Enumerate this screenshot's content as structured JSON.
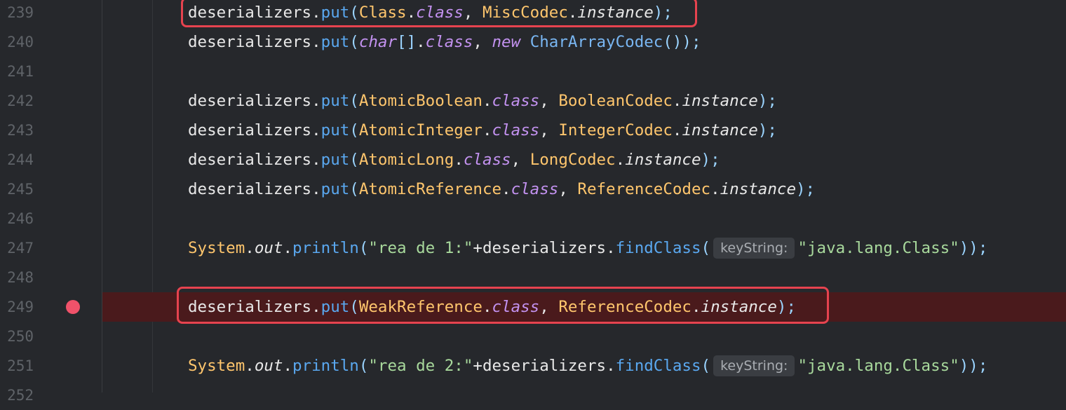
{
  "editor": {
    "lines": [
      {
        "num": "239",
        "parts": [
          {
            "t": "deserializers",
            "c": "t-obj"
          },
          {
            "t": ".",
            "c": "t-dot"
          },
          {
            "t": "put",
            "c": "t-meth"
          },
          {
            "t": "(",
            "c": "t-punc"
          },
          {
            "t": "Class",
            "c": "t-cls"
          },
          {
            "t": ".",
            "c": "t-dot"
          },
          {
            "t": "class",
            "c": "t-kw"
          },
          {
            "t": ", ",
            "c": "t-obj"
          },
          {
            "t": "MiscCodec",
            "c": "t-cls"
          },
          {
            "t": ".",
            "c": "t-dot"
          },
          {
            "t": "instance",
            "c": "t-inst"
          },
          {
            "t": ");",
            "c": "t-punc"
          }
        ]
      },
      {
        "num": "240",
        "parts": [
          {
            "t": "deserializers",
            "c": "t-obj"
          },
          {
            "t": ".",
            "c": "t-dot"
          },
          {
            "t": "put",
            "c": "t-meth"
          },
          {
            "t": "(",
            "c": "t-punc"
          },
          {
            "t": "char",
            "c": "t-kw"
          },
          {
            "t": "[]",
            "c": "t-punc"
          },
          {
            "t": ".",
            "c": "t-dot"
          },
          {
            "t": "class",
            "c": "t-kw"
          },
          {
            "t": ", ",
            "c": "t-obj"
          },
          {
            "t": "new",
            "c": "t-kw"
          },
          {
            "t": " ",
            "c": "t-obj"
          },
          {
            "t": "CharArrayCodec",
            "c": "t-newcls"
          },
          {
            "t": "());",
            "c": "t-punc"
          }
        ]
      },
      {
        "num": "241",
        "parts": []
      },
      {
        "num": "242",
        "parts": [
          {
            "t": "deserializers",
            "c": "t-obj"
          },
          {
            "t": ".",
            "c": "t-dot"
          },
          {
            "t": "put",
            "c": "t-meth"
          },
          {
            "t": "(",
            "c": "t-punc"
          },
          {
            "t": "AtomicBoolean",
            "c": "t-cls"
          },
          {
            "t": ".",
            "c": "t-dot"
          },
          {
            "t": "class",
            "c": "t-kw"
          },
          {
            "t": ", ",
            "c": "t-obj"
          },
          {
            "t": "BooleanCodec",
            "c": "t-cls"
          },
          {
            "t": ".",
            "c": "t-dot"
          },
          {
            "t": "instance",
            "c": "t-inst"
          },
          {
            "t": ");",
            "c": "t-punc"
          }
        ]
      },
      {
        "num": "243",
        "parts": [
          {
            "t": "deserializers",
            "c": "t-obj"
          },
          {
            "t": ".",
            "c": "t-dot"
          },
          {
            "t": "put",
            "c": "t-meth"
          },
          {
            "t": "(",
            "c": "t-punc"
          },
          {
            "t": "AtomicInteger",
            "c": "t-cls"
          },
          {
            "t": ".",
            "c": "t-dot"
          },
          {
            "t": "class",
            "c": "t-kw"
          },
          {
            "t": ", ",
            "c": "t-obj"
          },
          {
            "t": "IntegerCodec",
            "c": "t-cls"
          },
          {
            "t": ".",
            "c": "t-dot"
          },
          {
            "t": "instance",
            "c": "t-inst"
          },
          {
            "t": ");",
            "c": "t-punc"
          }
        ]
      },
      {
        "num": "244",
        "parts": [
          {
            "t": "deserializers",
            "c": "t-obj"
          },
          {
            "t": ".",
            "c": "t-dot"
          },
          {
            "t": "put",
            "c": "t-meth"
          },
          {
            "t": "(",
            "c": "t-punc"
          },
          {
            "t": "AtomicLong",
            "c": "t-cls"
          },
          {
            "t": ".",
            "c": "t-dot"
          },
          {
            "t": "class",
            "c": "t-kw"
          },
          {
            "t": ", ",
            "c": "t-obj"
          },
          {
            "t": "LongCodec",
            "c": "t-cls"
          },
          {
            "t": ".",
            "c": "t-dot"
          },
          {
            "t": "instance",
            "c": "t-inst"
          },
          {
            "t": ");",
            "c": "t-punc"
          }
        ]
      },
      {
        "num": "245",
        "parts": [
          {
            "t": "deserializers",
            "c": "t-obj"
          },
          {
            "t": ".",
            "c": "t-dot"
          },
          {
            "t": "put",
            "c": "t-meth"
          },
          {
            "t": "(",
            "c": "t-punc"
          },
          {
            "t": "AtomicReference",
            "c": "t-cls"
          },
          {
            "t": ".",
            "c": "t-dot"
          },
          {
            "t": "class",
            "c": "t-kw"
          },
          {
            "t": ", ",
            "c": "t-obj"
          },
          {
            "t": "ReferenceCodec",
            "c": "t-cls"
          },
          {
            "t": ".",
            "c": "t-dot"
          },
          {
            "t": "instance",
            "c": "t-inst"
          },
          {
            "t": ");",
            "c": "t-punc"
          }
        ]
      },
      {
        "num": "246",
        "parts": []
      },
      {
        "num": "247",
        "parts": [
          {
            "t": "System",
            "c": "t-cls"
          },
          {
            "t": ".",
            "c": "t-dot"
          },
          {
            "t": "out",
            "c": "t-out"
          },
          {
            "t": ".",
            "c": "t-dot"
          },
          {
            "t": "println",
            "c": "t-meth"
          },
          {
            "t": "(",
            "c": "t-punc"
          },
          {
            "t": "\"rea de 1:\"",
            "c": "t-str"
          },
          {
            "t": "+",
            "c": "t-obj"
          },
          {
            "t": "deserializers",
            "c": "t-obj"
          },
          {
            "t": ".",
            "c": "t-dot"
          },
          {
            "t": "findClass",
            "c": "t-find"
          },
          {
            "t": "(",
            "c": "t-punc"
          },
          {
            "hint": "keyString:"
          },
          {
            "t": "\"java.lang.Class\"",
            "c": "t-str"
          },
          {
            "t": "));",
            "c": "t-punc"
          }
        ]
      },
      {
        "num": "248",
        "parts": []
      },
      {
        "num": "249",
        "parts": [
          {
            "t": "deserializers",
            "c": "t-obj"
          },
          {
            "t": ".",
            "c": "t-dot"
          },
          {
            "t": "put",
            "c": "t-meth"
          },
          {
            "t": "(",
            "c": "t-punc"
          },
          {
            "t": "WeakReference",
            "c": "t-cls"
          },
          {
            "t": ".",
            "c": "t-dot"
          },
          {
            "t": "class",
            "c": "t-kw"
          },
          {
            "t": ", ",
            "c": "t-obj"
          },
          {
            "t": "ReferenceCodec",
            "c": "t-cls"
          },
          {
            "t": ".",
            "c": "t-dot"
          },
          {
            "t": "instance",
            "c": "t-inst"
          },
          {
            "t": ");",
            "c": "t-punc"
          }
        ],
        "breakpoint": true
      },
      {
        "num": "250",
        "parts": []
      },
      {
        "num": "251",
        "parts": [
          {
            "t": "System",
            "c": "t-cls"
          },
          {
            "t": ".",
            "c": "t-dot"
          },
          {
            "t": "out",
            "c": "t-out"
          },
          {
            "t": ".",
            "c": "t-dot"
          },
          {
            "t": "println",
            "c": "t-meth"
          },
          {
            "t": "(",
            "c": "t-punc"
          },
          {
            "t": "\"rea de 2:\"",
            "c": "t-str"
          },
          {
            "t": "+",
            "c": "t-obj"
          },
          {
            "t": "deserializers",
            "c": "t-obj"
          },
          {
            "t": ".",
            "c": "t-dot"
          },
          {
            "t": "findClass",
            "c": "t-find"
          },
          {
            "t": "(",
            "c": "t-punc"
          },
          {
            "hint": "keyString:"
          },
          {
            "t": "\"java.lang.Class\"",
            "c": "t-str"
          },
          {
            "t": "));",
            "c": "t-punc"
          }
        ]
      },
      {
        "num": "252",
        "parts": []
      }
    ],
    "colors": {
      "background": "#26282c",
      "breakpoint": "#f0526a",
      "breakpoint_line": "#4a1a1c",
      "highlight_box": "#e6434f"
    }
  }
}
